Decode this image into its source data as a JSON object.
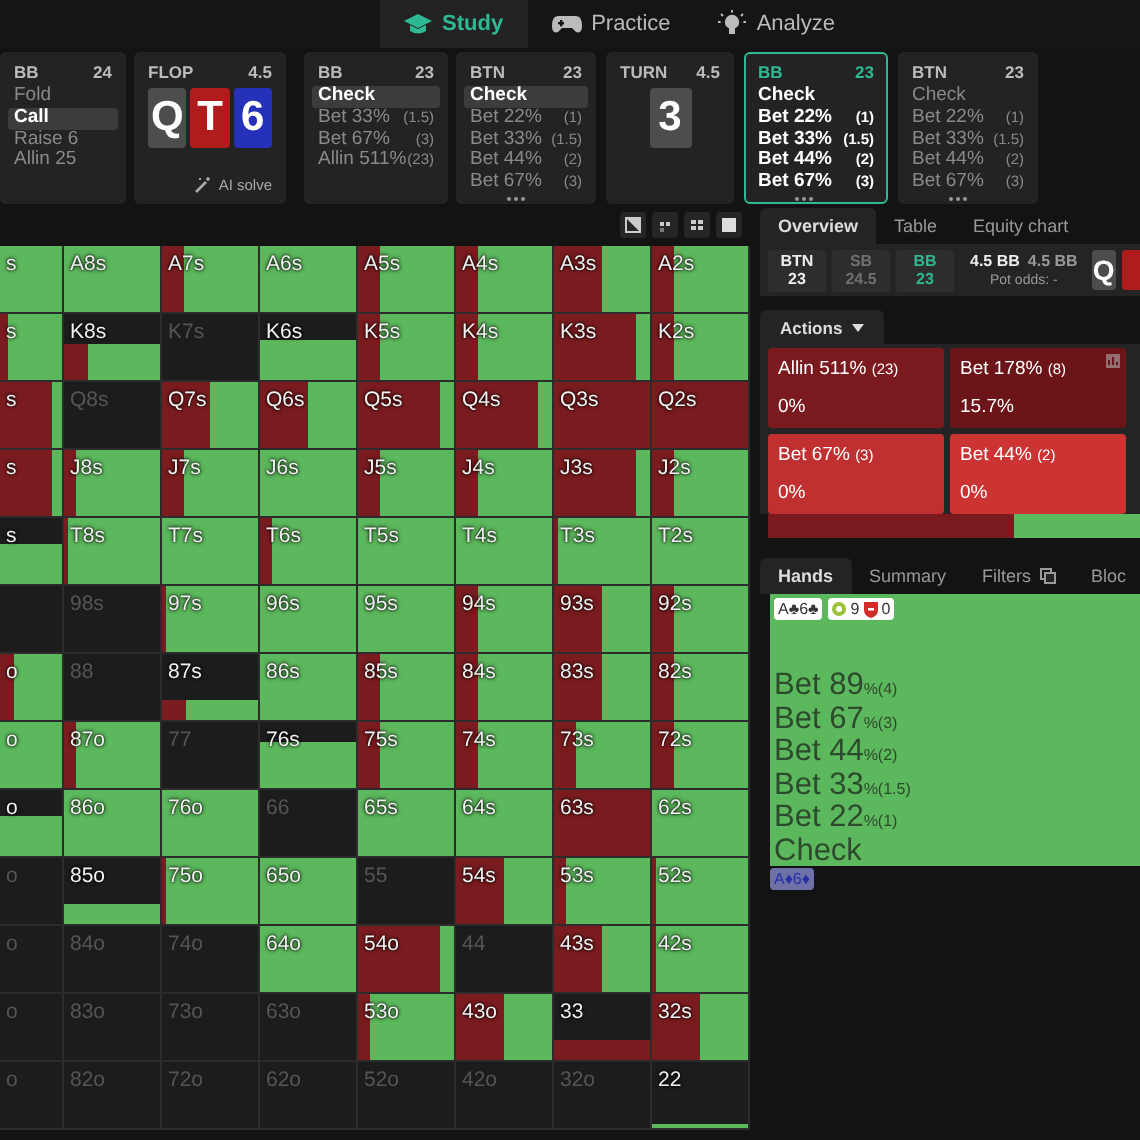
{
  "nav": [
    {
      "label": "Study",
      "selected": true
    },
    {
      "label": "Practice",
      "selected": false
    },
    {
      "label": "Analyze",
      "selected": false
    }
  ],
  "action_cards": [
    {
      "kind": "actions",
      "player": "BB",
      "stack": "24",
      "active": false,
      "options": [
        {
          "label": "Fold",
          "selected": false
        },
        {
          "label": "Call",
          "selected": true
        },
        {
          "label": "Raise 6",
          "selected": false
        },
        {
          "label": "Allin 25",
          "selected": false
        }
      ]
    },
    {
      "kind": "board",
      "street": "FLOP",
      "pot": "4.5",
      "cards": [
        {
          "rank": "Q",
          "color": "#4d4d4d"
        },
        {
          "rank": "T",
          "color": "#b01b1b"
        },
        {
          "rank": "6",
          "color": "#2531b8"
        }
      ],
      "footer": "AI solve"
    },
    {
      "kind": "actions",
      "player": "BB",
      "stack": "23",
      "active": false,
      "options": [
        {
          "label": "Check",
          "selected": true
        },
        {
          "label": "Bet 33%",
          "size": "(1.5)",
          "selected": false
        },
        {
          "label": "Bet 67%",
          "size": "(3)",
          "selected": false
        },
        {
          "label": "Allin 511%",
          "size": "(23)",
          "selected": false
        }
      ]
    },
    {
      "kind": "actions",
      "player": "BTN",
      "stack": "23",
      "active": false,
      "more": true,
      "options": [
        {
          "label": "Check",
          "selected": true
        },
        {
          "label": "Bet 22%",
          "size": "(1)",
          "selected": false
        },
        {
          "label": "Bet 33%",
          "size": "(1.5)",
          "selected": false
        },
        {
          "label": "Bet 44%",
          "size": "(2)",
          "selected": false
        },
        {
          "label": "Bet 67%",
          "size": "(3)",
          "selected": false
        }
      ]
    },
    {
      "kind": "board",
      "street": "TURN",
      "pot": "4.5",
      "cards": [
        {
          "rank": "3",
          "color": "#4d4d4d"
        }
      ]
    },
    {
      "kind": "actions",
      "player": "BB",
      "stack": "23",
      "active": true,
      "more": true,
      "options": [
        {
          "label": "Check",
          "selected": false
        },
        {
          "label": "Bet 22%",
          "size": "(1)",
          "selected": false
        },
        {
          "label": "Bet 33%",
          "size": "(1.5)",
          "selected": false
        },
        {
          "label": "Bet 44%",
          "size": "(2)",
          "selected": false
        },
        {
          "label": "Bet 67%",
          "size": "(3)",
          "selected": false
        }
      ]
    },
    {
      "kind": "actions",
      "player": "BTN",
      "stack": "23",
      "active": false,
      "more": true,
      "options": [
        {
          "label": "Check",
          "selected": false
        },
        {
          "label": "Bet 22%",
          "size": "(1)",
          "selected": false
        },
        {
          "label": "Bet 33%",
          "size": "(1.5)",
          "selected": false
        },
        {
          "label": "Bet 44%",
          "size": "(2)",
          "selected": false
        },
        {
          "label": "Bet 67%",
          "size": "(3)",
          "selected": false
        }
      ]
    }
  ],
  "range_grid": {
    "rows": [
      [
        {
          "label": "s",
          "kind": "check"
        },
        {
          "label": "A8s",
          "kind": "check"
        },
        {
          "label": "A7s",
          "kind": "light_bet"
        },
        {
          "label": "A6s",
          "kind": "check"
        },
        {
          "label": "A5s",
          "kind": "light_bet"
        },
        {
          "label": "A4s",
          "kind": "light_bet"
        },
        {
          "label": "A3s",
          "kind": "mixed"
        },
        {
          "label": "A2s",
          "kind": "light_bet"
        }
      ],
      [
        {
          "label": "s",
          "kind": "slight_bet"
        },
        {
          "label": "K8s",
          "kind": "half_light_bet"
        },
        {
          "label": "K7s",
          "kind": "empty"
        },
        {
          "label": "K6s",
          "kind": "half_check"
        },
        {
          "label": "K5s",
          "kind": "light_bet"
        },
        {
          "label": "K4s",
          "kind": "light_bet"
        },
        {
          "label": "K3s",
          "kind": "heavy_bet"
        },
        {
          "label": "K2s",
          "kind": "light_bet"
        }
      ],
      [
        {
          "label": "s",
          "kind": "heavy_bet"
        },
        {
          "label": "Q8s",
          "kind": "empty"
        },
        {
          "label": "Q7s",
          "kind": "mixed"
        },
        {
          "label": "Q6s",
          "kind": "mixed"
        },
        {
          "label": "Q5s",
          "kind": "heavy_bet"
        },
        {
          "label": "Q4s",
          "kind": "heavy_bet"
        },
        {
          "label": "Q3s",
          "kind": "bet"
        },
        {
          "label": "Q2s",
          "kind": "bet"
        }
      ],
      [
        {
          "label": "s",
          "kind": "heavy_bet"
        },
        {
          "label": "J8s",
          "kind": "slight_bet"
        },
        {
          "label": "J7s",
          "kind": "light_bet"
        },
        {
          "label": "J6s",
          "kind": "check"
        },
        {
          "label": "J5s",
          "kind": "light_bet"
        },
        {
          "label": "J4s",
          "kind": "light_bet"
        },
        {
          "label": "J3s",
          "kind": "heavy_bet"
        },
        {
          "label": "J2s",
          "kind": "light_bet"
        }
      ],
      [
        {
          "label": "s",
          "kind": "half_check"
        },
        {
          "label": "T8s",
          "kind": "trace_bet"
        },
        {
          "label": "T7s",
          "kind": "check"
        },
        {
          "label": "T6s",
          "kind": "slight_bet"
        },
        {
          "label": "T5s",
          "kind": "check"
        },
        {
          "label": "T4s",
          "kind": "check"
        },
        {
          "label": "T3s",
          "kind": "trace_bet"
        },
        {
          "label": "T2s",
          "kind": "check"
        }
      ],
      [
        {
          "kind": "empty"
        },
        {
          "label": "98s",
          "kind": "empty"
        },
        {
          "label": "97s",
          "kind": "trace_bet"
        },
        {
          "label": "96s",
          "kind": "check"
        },
        {
          "label": "95s",
          "kind": "check"
        },
        {
          "label": "94s",
          "kind": "light_bet"
        },
        {
          "label": "93s",
          "kind": "mixed"
        },
        {
          "label": "92s",
          "kind": "light_bet"
        }
      ],
      [
        {
          "label": "o",
          "kind": "light_bet"
        },
        {
          "label": "88",
          "kind": "empty"
        },
        {
          "label": "87s",
          "kind": "low_light_bet"
        },
        {
          "label": "86s",
          "kind": "check"
        },
        {
          "label": "85s",
          "kind": "light_bet"
        },
        {
          "label": "84s",
          "kind": "light_bet"
        },
        {
          "label": "83s",
          "kind": "mixed"
        },
        {
          "label": "82s",
          "kind": "light_bet"
        }
      ],
      [
        {
          "label": "o",
          "kind": "check"
        },
        {
          "label": "87o",
          "kind": "slight_bet"
        },
        {
          "label": "77",
          "kind": "empty"
        },
        {
          "label": "76s",
          "kind": "high_check"
        },
        {
          "label": "75s",
          "kind": "light_bet"
        },
        {
          "label": "74s",
          "kind": "light_bet"
        },
        {
          "label": "73s",
          "kind": "light_bet"
        },
        {
          "label": "72s",
          "kind": "light_bet"
        }
      ],
      [
        {
          "label": "o",
          "kind": "half_check"
        },
        {
          "label": "86o",
          "kind": "check"
        },
        {
          "label": "76o",
          "kind": "check"
        },
        {
          "label": "66",
          "kind": "empty"
        },
        {
          "label": "65s",
          "kind": "check"
        },
        {
          "label": "64s",
          "kind": "check"
        },
        {
          "label": "63s",
          "kind": "bet"
        },
        {
          "label": "62s",
          "kind": "check"
        }
      ],
      [
        {
          "label": "o",
          "kind": "empty"
        },
        {
          "label": "85o",
          "kind": "low_check"
        },
        {
          "label": "75o",
          "kind": "trace_bet"
        },
        {
          "label": "65o",
          "kind": "check"
        },
        {
          "label": "55",
          "kind": "empty"
        },
        {
          "label": "54s",
          "kind": "mixed"
        },
        {
          "label": "53s",
          "kind": "slight_bet"
        },
        {
          "label": "52s",
          "kind": "trace_bet"
        }
      ],
      [
        {
          "label": "o",
          "kind": "empty"
        },
        {
          "label": "84o",
          "kind": "empty"
        },
        {
          "label": "74o",
          "kind": "empty"
        },
        {
          "label": "64o",
          "kind": "check"
        },
        {
          "label": "54o",
          "kind": "heavy_bet"
        },
        {
          "label": "44",
          "kind": "empty"
        },
        {
          "label": "43s",
          "kind": "mixed"
        },
        {
          "label": "42s",
          "kind": "trace_bet"
        }
      ],
      [
        {
          "label": "o",
          "kind": "empty"
        },
        {
          "label": "83o",
          "kind": "empty"
        },
        {
          "label": "73o",
          "kind": "empty"
        },
        {
          "label": "63o",
          "kind": "empty"
        },
        {
          "label": "53o",
          "kind": "slight_bet"
        },
        {
          "label": "43o",
          "kind": "mixed"
        },
        {
          "label": "33",
          "kind": "low_bet"
        },
        {
          "label": "32s",
          "kind": "mixed"
        }
      ],
      [
        {
          "label": "o",
          "kind": "empty"
        },
        {
          "label": "82o",
          "kind": "empty"
        },
        {
          "label": "72o",
          "kind": "empty"
        },
        {
          "label": "62o",
          "kind": "empty"
        },
        {
          "label": "52o",
          "kind": "empty"
        },
        {
          "label": "42o",
          "kind": "empty"
        },
        {
          "label": "32o",
          "kind": "empty"
        },
        {
          "label": "22",
          "kind": "trace_check"
        }
      ]
    ]
  },
  "panel": {
    "tabs": [
      {
        "label": "Overview",
        "selected": true
      },
      {
        "label": "Table",
        "selected": false
      },
      {
        "label": "Equity chart",
        "selected": false
      }
    ],
    "players": [
      {
        "name": "BTN",
        "stack": "23",
        "folded": false,
        "acting": false
      },
      {
        "name": "SB",
        "stack": "24.5",
        "folded": true,
        "acting": false
      },
      {
        "name": "BB",
        "stack": "23",
        "folded": false,
        "acting": true
      }
    ],
    "pot": "4.5 BB",
    "pot_start": "4.5 BB",
    "pot_odds": "Pot odds: -",
    "board": [
      {
        "rank": "Q",
        "color": "#4d4d4d"
      },
      {
        "color": "#b01b1b"
      }
    ],
    "section_tab": "Actions",
    "action_tiles": [
      {
        "label": "Allin 511%",
        "size": "(23)",
        "value": "0%",
        "color": "#7a1a1e",
        "flag": false
      },
      {
        "label": "Bet 178%",
        "size": "(8)",
        "value": "15.7%",
        "color": "#6b1518",
        "flag": true
      },
      {
        "label": "Bet 67%",
        "size": "(3)",
        "value": "0%",
        "color": "#c13030",
        "flag": false
      },
      {
        "label": "Bet 44%",
        "size": "(2)",
        "value": "0%",
        "color": "#cc3434",
        "flag": false
      }
    ],
    "strategy_bar": {
      "level": 0.66
    },
    "hand_tabs": [
      {
        "label": "Hands",
        "selected": true,
        "kind": "text"
      },
      {
        "label": "Summary",
        "selected": false,
        "kind": "text"
      },
      {
        "label": "Filters",
        "selected": false,
        "kind": "with_icon"
      },
      {
        "label": "Bloc",
        "selected": false,
        "kind": "text"
      }
    ],
    "hand": {
      "combo": "A♣6♣",
      "badges": [
        {
          "kind": "good",
          "count": "9"
        },
        {
          "kind": "bad",
          "count": "0"
        }
      ],
      "lines": [
        {
          "label": "Bet 89",
          "suffix": "%(4)"
        },
        {
          "label": "Bet 67",
          "suffix": "%(3)"
        },
        {
          "label": "Bet 44",
          "suffix": "%(2)"
        },
        {
          "label": "Bet 33",
          "suffix": "%(1.5)"
        },
        {
          "label": "Bet 22",
          "suffix": "%(1)"
        },
        {
          "label": "Check"
        }
      ]
    },
    "next_combo": "A♦6♦"
  }
}
